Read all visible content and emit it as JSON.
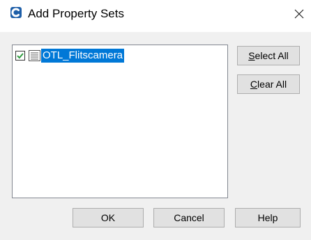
{
  "dialog": {
    "title": "Add Property Sets",
    "close_glyph": "✕"
  },
  "list": {
    "items": [
      {
        "label": "OTL_Flitscamera",
        "checked": true,
        "icon": "property-set-icon"
      }
    ]
  },
  "side_buttons": {
    "select_all_accel": "S",
    "select_all_rest": "elect All",
    "clear_all_accel": "C",
    "clear_all_rest": "lear All"
  },
  "footer_buttons": {
    "ok": "OK",
    "cancel": "Cancel",
    "help": "Help"
  },
  "colors": {
    "selection": "#0078d7",
    "check": "#2e9b3e",
    "app_icon": "#1e5fa8"
  }
}
